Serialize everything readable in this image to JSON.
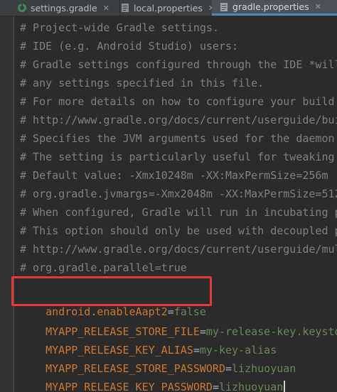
{
  "tabs": [
    {
      "label": "settings.gradle",
      "icon": "gradle-icon",
      "active": false
    },
    {
      "label": "local.properties",
      "icon": "properties-file-icon",
      "active": false
    },
    {
      "label": "gradle.properties",
      "icon": "properties-file-icon",
      "active": true
    }
  ],
  "editor": {
    "comments": [
      "# Project-wide Gradle settings.",
      "# IDE (e.g. Android Studio) users:",
      "# Gradle settings configured through the IDE *will",
      "# any settings specified in this file.",
      "# For more details on how to configure your build",
      "# http://www.gradle.org/docs/current/userguide/bui",
      "# Specifies the JVM arguments used for the daemon",
      "# The setting is particularly useful for tweaking",
      "# Default value: -Xmx10248m -XX:MaxPermSize=256m",
      "# org.gradle.jvmargs=-Xmx2048m -XX:MaxPermSize=512",
      "# When configured, Gradle will run in incubating p",
      "# This option should only be used with decoupled p",
      "# http://www.gradle.org/docs/current/userguide/mul",
      "# org.gradle.parallel=true"
    ],
    "properties": [
      {
        "key": "android.enableAapt2",
        "eq": "=",
        "value": "false"
      },
      {
        "key": "MYAPP_RELEASE_STORE_FILE",
        "eq": "=",
        "value": "my-release-key.keystore"
      },
      {
        "key": "MYAPP_RELEASE_KEY_ALIAS",
        "eq": "=",
        "value": "my-key-alias"
      },
      {
        "key": "MYAPP_RELEASE_STORE_PASSWORD",
        "eq": "=",
        "value": "lizhuoyuan"
      },
      {
        "key": "MYAPP_RELEASE_KEY_PASSWORD",
        "eq": "=",
        "value": "lizhuoyuan"
      }
    ]
  },
  "colors": {
    "background": "#2b2b2b",
    "comment": "#808080",
    "key": "#cc7832",
    "value": "#6a8759",
    "highlight_box": "#e5393c"
  }
}
